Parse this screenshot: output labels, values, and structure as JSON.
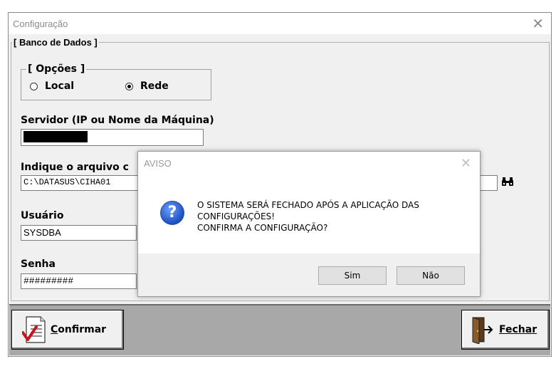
{
  "window": {
    "title": "Configuração",
    "close_glyph": "✕"
  },
  "banco": {
    "legend": "[ Banco de Dados ]",
    "opcoes": {
      "legend": "[ Opções ]",
      "local_label": "Local",
      "rede_label": "Rede",
      "selected": "Rede"
    },
    "servidor": {
      "label": "Servidor (IP ou Nome da Máquina)",
      "value": ""
    },
    "arquivo": {
      "label": "Indique o arquivo c",
      "value": "C:\\DATASUS\\CIHA01",
      "search_icon": "binoculars-icon"
    },
    "usuario": {
      "label": "Usuário",
      "value": "SYSDBA"
    },
    "senha": {
      "label": "Senha",
      "value": "#########"
    }
  },
  "buttons": {
    "confirmar": {
      "label_underlined": "C",
      "label_rest": "onfirmar",
      "icon": "document-check-icon"
    },
    "fechar": {
      "label_underlined": "F",
      "label_rest": "echar",
      "icon": "door-exit-icon"
    }
  },
  "dialog": {
    "title": "AVISO",
    "close_glyph": "✕",
    "icon": "question-icon",
    "icon_glyph": "?",
    "lines": [
      "O SISTEMA SERÁ FECHADO APÓS A APLICAÇÃO DAS",
      "CONFIGURAÇÕES!",
      "CONFIRMA A CONFIGURAÇÃO?"
    ],
    "yes_label": "Sim",
    "no_label": "Não"
  },
  "colors": {
    "question_icon": "#1c4fc2",
    "bottom_bar": "#a8a8a8"
  }
}
